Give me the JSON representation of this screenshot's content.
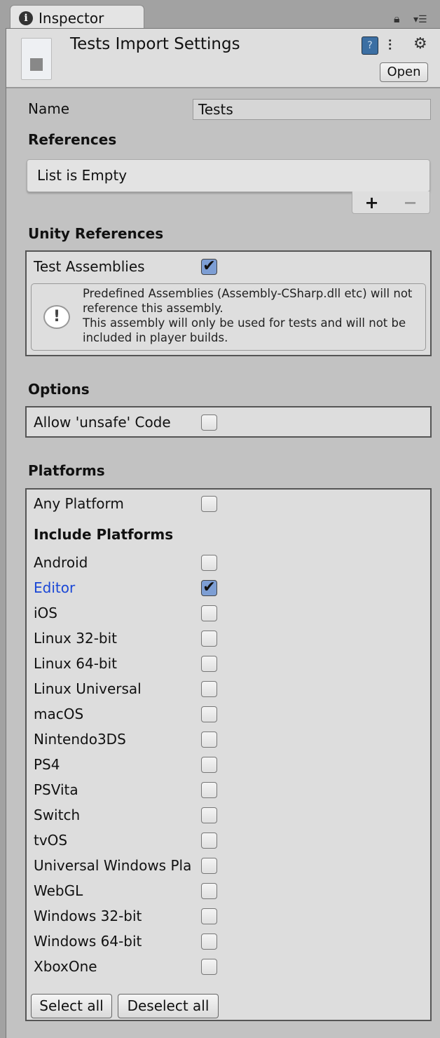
{
  "tab": {
    "label": "Inspector"
  },
  "header": {
    "title": "Tests Import Settings",
    "open_label": "Open"
  },
  "name": {
    "label": "Name",
    "value": "Tests"
  },
  "references": {
    "heading": "References",
    "empty_text": "List is Empty",
    "add": "+",
    "remove": "−"
  },
  "unity_references": {
    "heading": "Unity References",
    "test_assemblies_label": "Test Assemblies",
    "test_assemblies_checked": true,
    "help_text_1": "Predefined Assemblies (Assembly-CSharp.dll etc) will not reference this assembly.",
    "help_text_2": "This assembly will only be used for tests and will not be included in player builds."
  },
  "options": {
    "heading": "Options",
    "unsafe_label": "Allow 'unsafe' Code",
    "unsafe_checked": false
  },
  "platforms": {
    "heading": "Platforms",
    "any_label": "Any Platform",
    "any_checked": false,
    "include_heading": "Include Platforms",
    "items": [
      {
        "label": "Android",
        "checked": false
      },
      {
        "label": "Editor",
        "checked": true
      },
      {
        "label": "iOS",
        "checked": false
      },
      {
        "label": "Linux 32-bit",
        "checked": false
      },
      {
        "label": "Linux 64-bit",
        "checked": false
      },
      {
        "label": "Linux Universal",
        "checked": false
      },
      {
        "label": "macOS",
        "checked": false
      },
      {
        "label": "Nintendo3DS",
        "checked": false
      },
      {
        "label": "PS4",
        "checked": false
      },
      {
        "label": "PSVita",
        "checked": false
      },
      {
        "label": "Switch",
        "checked": false
      },
      {
        "label": "tvOS",
        "checked": false
      },
      {
        "label": "Universal Windows Pla",
        "checked": false
      },
      {
        "label": "WebGL",
        "checked": false
      },
      {
        "label": "Windows 32-bit",
        "checked": false
      },
      {
        "label": "Windows 64-bit",
        "checked": false
      },
      {
        "label": "XboxOne",
        "checked": false
      }
    ],
    "select_all": "Select all",
    "deselect_all": "Deselect all"
  },
  "colors": {
    "highlight_text": "#1a47d6",
    "checkbox_on": "#7d9ed4"
  }
}
